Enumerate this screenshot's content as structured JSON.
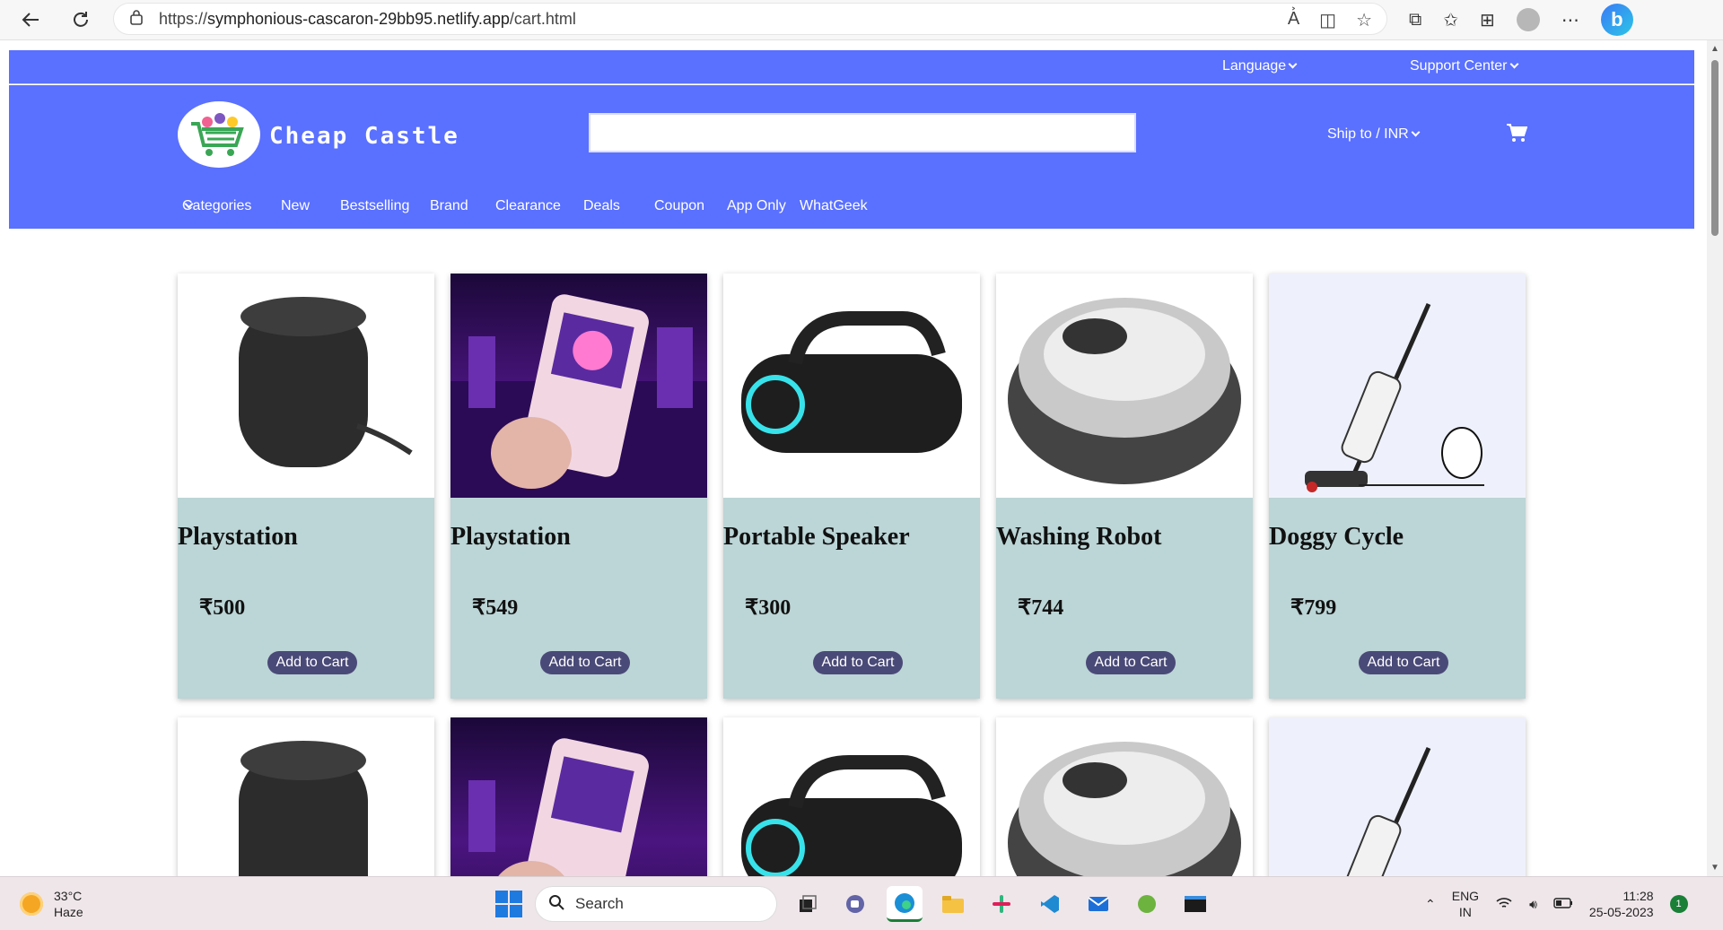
{
  "browser": {
    "url_prefix": "https://",
    "url_host": "symphonious-cascaron-29bb95.netlify.app",
    "url_path": "/cart.html"
  },
  "site": {
    "top_links": {
      "language": "Language",
      "support": "Support Center"
    },
    "brand": "Cheap Castle",
    "search_placeholder": "",
    "ship_to": "Ship to / INR",
    "menu": [
      "Categories",
      "New",
      "Bestselling",
      "Brand",
      "Clearance",
      "Deals",
      "Coupon",
      "App Only",
      "WhatGeek"
    ]
  },
  "products": [
    {
      "name": "Playstation",
      "price": "₹500",
      "button": "Add to Cart",
      "image": "cylinder-speaker"
    },
    {
      "name": "Playstation",
      "price": "₹549",
      "button": "Add to Cart",
      "image": "handheld-console"
    },
    {
      "name": "Portable Speaker",
      "price": "₹300",
      "button": "Add to Cart",
      "image": "portable-speaker"
    },
    {
      "name": "Washing Robot",
      "price": "₹744",
      "button": "Add to Cart",
      "image": "robot-vacuum"
    },
    {
      "name": "Doggy Cycle",
      "price": "₹799",
      "button": "Add to Cart",
      "image": "stick-vacuum"
    }
  ],
  "taskbar": {
    "temperature": "33°C",
    "condition": "Haze",
    "search": "Search",
    "lang_top": "ENG",
    "lang_bottom": "IN",
    "time": "11:28",
    "date": "25-05-2023",
    "notifications": "1"
  },
  "colors": {
    "header": "#5a70ff",
    "card": "#bcd5d6",
    "button": "#4a4a78"
  }
}
